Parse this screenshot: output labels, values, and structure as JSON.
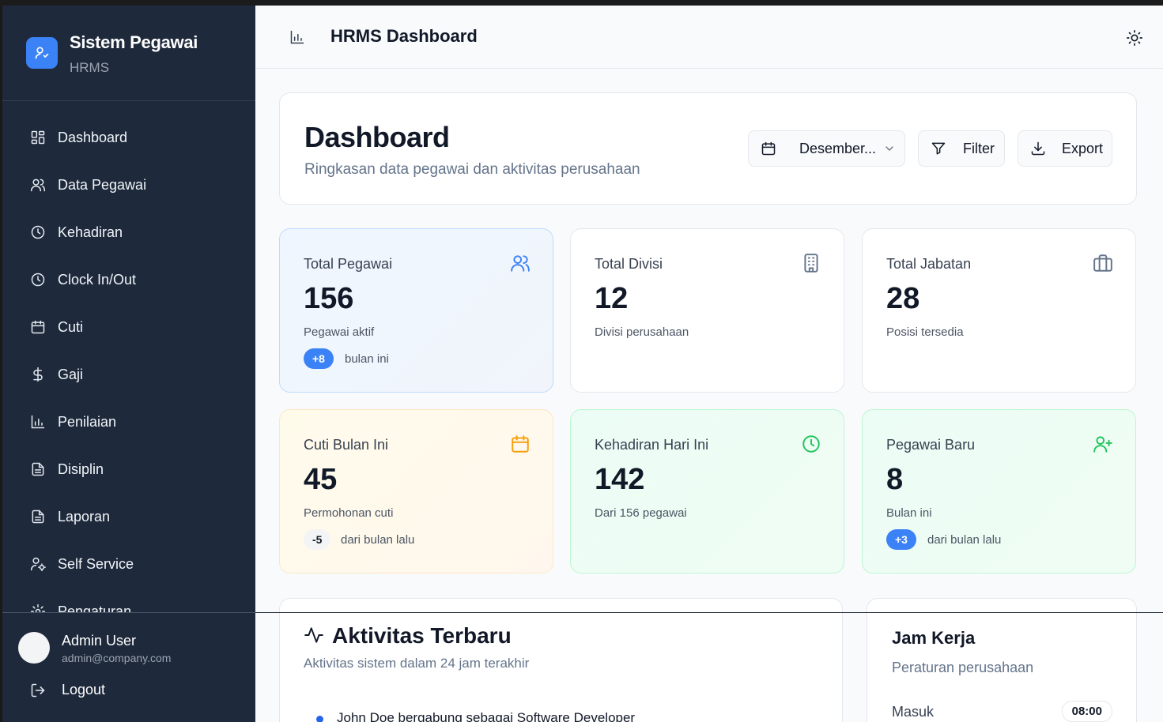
{
  "sidebar": {
    "brand": {
      "title": "Sistem Pegawai",
      "subtitle": "HRMS"
    },
    "items": [
      {
        "label": "Dashboard",
        "icon": "layout-grid-icon"
      },
      {
        "label": "Data Pegawai",
        "icon": "users-icon"
      },
      {
        "label": "Kehadiran",
        "icon": "clock-icon"
      },
      {
        "label": "Clock In/Out",
        "icon": "clock-icon"
      },
      {
        "label": "Cuti",
        "icon": "calendar-icon"
      },
      {
        "label": "Gaji",
        "icon": "dollar-icon"
      },
      {
        "label": "Penilaian",
        "icon": "bar-chart-icon"
      },
      {
        "label": "Disiplin",
        "icon": "file-text-icon"
      },
      {
        "label": "Laporan",
        "icon": "file-text-icon"
      },
      {
        "label": "Self Service",
        "icon": "user-cog-icon"
      },
      {
        "label": "Pengaturan",
        "icon": "gear-icon"
      }
    ],
    "user": {
      "name": "Admin User",
      "email": "admin@company.com"
    },
    "logout_label": "Logout"
  },
  "header": {
    "title": "HRMS Dashboard",
    "icon": "bar-chart-icon",
    "theme_icon": "sun-icon"
  },
  "hero": {
    "title": "Dashboard",
    "subtitle": "Ringkasan data pegawai dan aktivitas perusahaan",
    "date_select": "Desember...",
    "filter_label": "Filter",
    "export_label": "Export"
  },
  "stats": [
    {
      "title": "Total Pegawai",
      "value": "156",
      "desc": "Pegawai aktif",
      "badge": "+8",
      "note": "bulan ini",
      "icon": "users-icon",
      "color": "#3b82f6"
    },
    {
      "title": "Total Divisi",
      "value": "12",
      "desc": "Divisi perusahaan",
      "icon": "building-icon",
      "color": "#64748b"
    },
    {
      "title": "Total Jabatan",
      "value": "28",
      "desc": "Posisi tersedia",
      "icon": "briefcase-icon",
      "color": "#64748b"
    },
    {
      "title": "Cuti Bulan Ini",
      "value": "45",
      "desc": "Permohonan cuti",
      "badge": "-5",
      "note": "dari bulan lalu",
      "icon": "calendar-icon",
      "color": "#f59e0b"
    },
    {
      "title": "Kehadiran Hari Ini",
      "value": "142",
      "desc": "Dari 156 pegawai",
      "icon": "clock-icon",
      "color": "#22c55e"
    },
    {
      "title": "Pegawai Baru",
      "value": "8",
      "desc": "Bulan ini",
      "badge": "+3",
      "note": "dari bulan lalu",
      "icon": "user-plus-icon",
      "color": "#22c55e"
    }
  ],
  "activity": {
    "title": "Aktivitas Terbaru",
    "subtitle": "Aktivitas sistem dalam 24 jam terakhir",
    "items": [
      "John Doe bergabung sebagai Software Developer"
    ]
  },
  "work_hours": {
    "title": "Jam Kerja",
    "subtitle": "Peraturan perusahaan",
    "rows": [
      {
        "label": "Masuk",
        "value": "08:00"
      }
    ]
  }
}
